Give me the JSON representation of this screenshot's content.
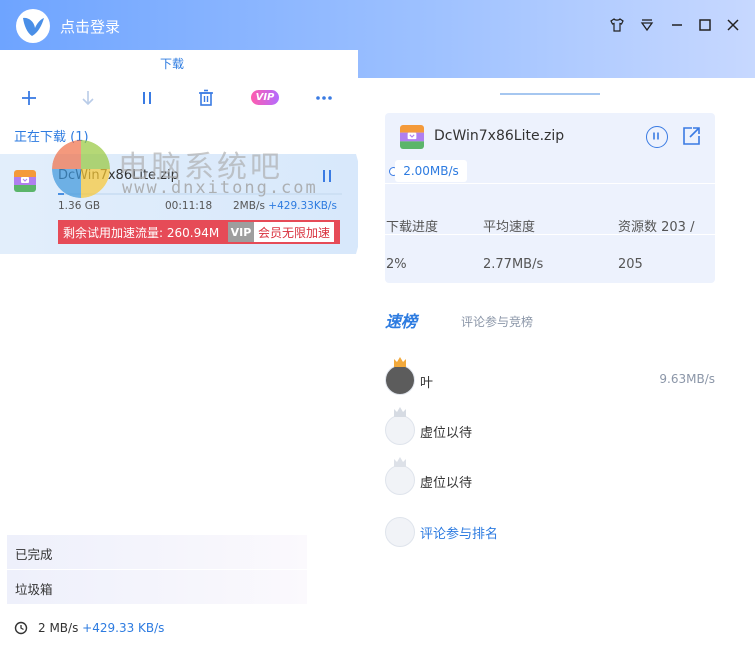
{
  "header": {
    "login_label": "点击登录"
  },
  "tabs": {
    "active_label": "下载"
  },
  "toolbar": {
    "vip_label": "VIP"
  },
  "downloading": {
    "section_label": "正在下载 (1)",
    "task": {
      "name": "DcWin7x86Lite.zip",
      "size": "1.36 GB",
      "time": "00:11:18",
      "speed_down": "2MB/s",
      "speed_up": "+429.33KB/s",
      "progress_percent": 2,
      "trial_text": "剩余试用加速流量: 260.94M",
      "trial_vip": "VIP",
      "trial_member": "会员无限加速"
    }
  },
  "watermark": {
    "text": "电脑系统吧",
    "url": "www.dnxitong.com"
  },
  "nav": {
    "completed": "已完成",
    "trash": "垃圾箱"
  },
  "status": {
    "down": "2 MB/s",
    "up": "+429.33 KB/s"
  },
  "detail": {
    "name": "DcWin7x86Lite.zip",
    "speed_pill": "2.00MB/s",
    "stats": {
      "progress_label": "下载进度",
      "avg_speed_label": "平均速度",
      "sources_label": "资源数 203 /",
      "progress_value": "2%",
      "avg_speed_value": "2.77MB/s",
      "sources_value": "205"
    }
  },
  "leaderboard": {
    "title": "速榜",
    "subtitle": "评论参与竞榜",
    "entries": [
      {
        "rank": "1",
        "name": "叶",
        "speed": "9.63MB/s"
      },
      {
        "rank": "2",
        "name": "虚位以待",
        "speed": ""
      },
      {
        "rank": "3",
        "name": "虚位以待",
        "speed": ""
      }
    ],
    "comment_link": "评论参与排名"
  },
  "colors": {
    "accent": "#2d7be0",
    "trial_red": "#e64b57"
  }
}
